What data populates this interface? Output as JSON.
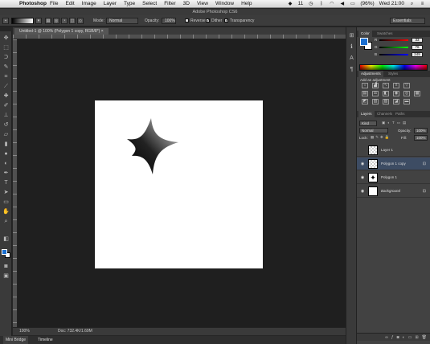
{
  "menubar": {
    "app_name": "Photoshop",
    "menus": [
      "File",
      "Edit",
      "Image",
      "Layer",
      "Type",
      "Select",
      "Filter",
      "3D",
      "View",
      "Window",
      "Help"
    ],
    "status": {
      "battery": "(96%)",
      "clock": "Wed 21:00",
      "badge": "11"
    }
  },
  "window_title": "Adobe Photoshop CS6",
  "options_bar": {
    "mode_label": "Mode:",
    "mode_value": "Normal",
    "opacity_label": "Opacity:",
    "opacity_value": "100%",
    "reverse_label": "Reverse",
    "dither_label": "Dither",
    "transparency_label": "Transparency",
    "reverse_checked": false,
    "dither_checked": true,
    "transparency_checked": true,
    "workspace_value": "Essentials"
  },
  "document": {
    "tab_title": "Untitled-1 @ 100% (Polygon 1 copy, RGB/8*) ×",
    "zoom": "100%",
    "doc_info": "Doc: 732.4K/1.69M"
  },
  "bottom_tabs": [
    "Mini Bridge",
    "Timeline"
  ],
  "color_panel": {
    "tabs": [
      "Color",
      "Swatches"
    ],
    "fg_color": "#1a6fd1",
    "bg_color": "#ffffff",
    "channels": [
      {
        "label": "R",
        "value": "33"
      },
      {
        "label": "G",
        "value": "76"
      },
      {
        "label": "B",
        "value": "249"
      }
    ]
  },
  "adjustments_panel": {
    "tabs": [
      "Adjustments",
      "Styles"
    ],
    "title": "Add an adjustment"
  },
  "layers_panel": {
    "tabs": [
      "Layers",
      "Channels",
      "Paths"
    ],
    "filter_value": "Kind",
    "blend_mode": "Normal",
    "opacity_label": "Opacity:",
    "opacity_value": "100%",
    "lock_label": "Lock:",
    "fill_label": "Fill:",
    "fill_value": "100%",
    "layers": [
      {
        "name": "Layer 1",
        "visible": false,
        "selected": false
      },
      {
        "name": "Polygon 1 copy",
        "visible": true,
        "selected": true
      },
      {
        "name": "Polygon 1",
        "visible": true,
        "selected": false
      },
      {
        "name": "Background",
        "visible": true,
        "selected": false
      }
    ]
  }
}
